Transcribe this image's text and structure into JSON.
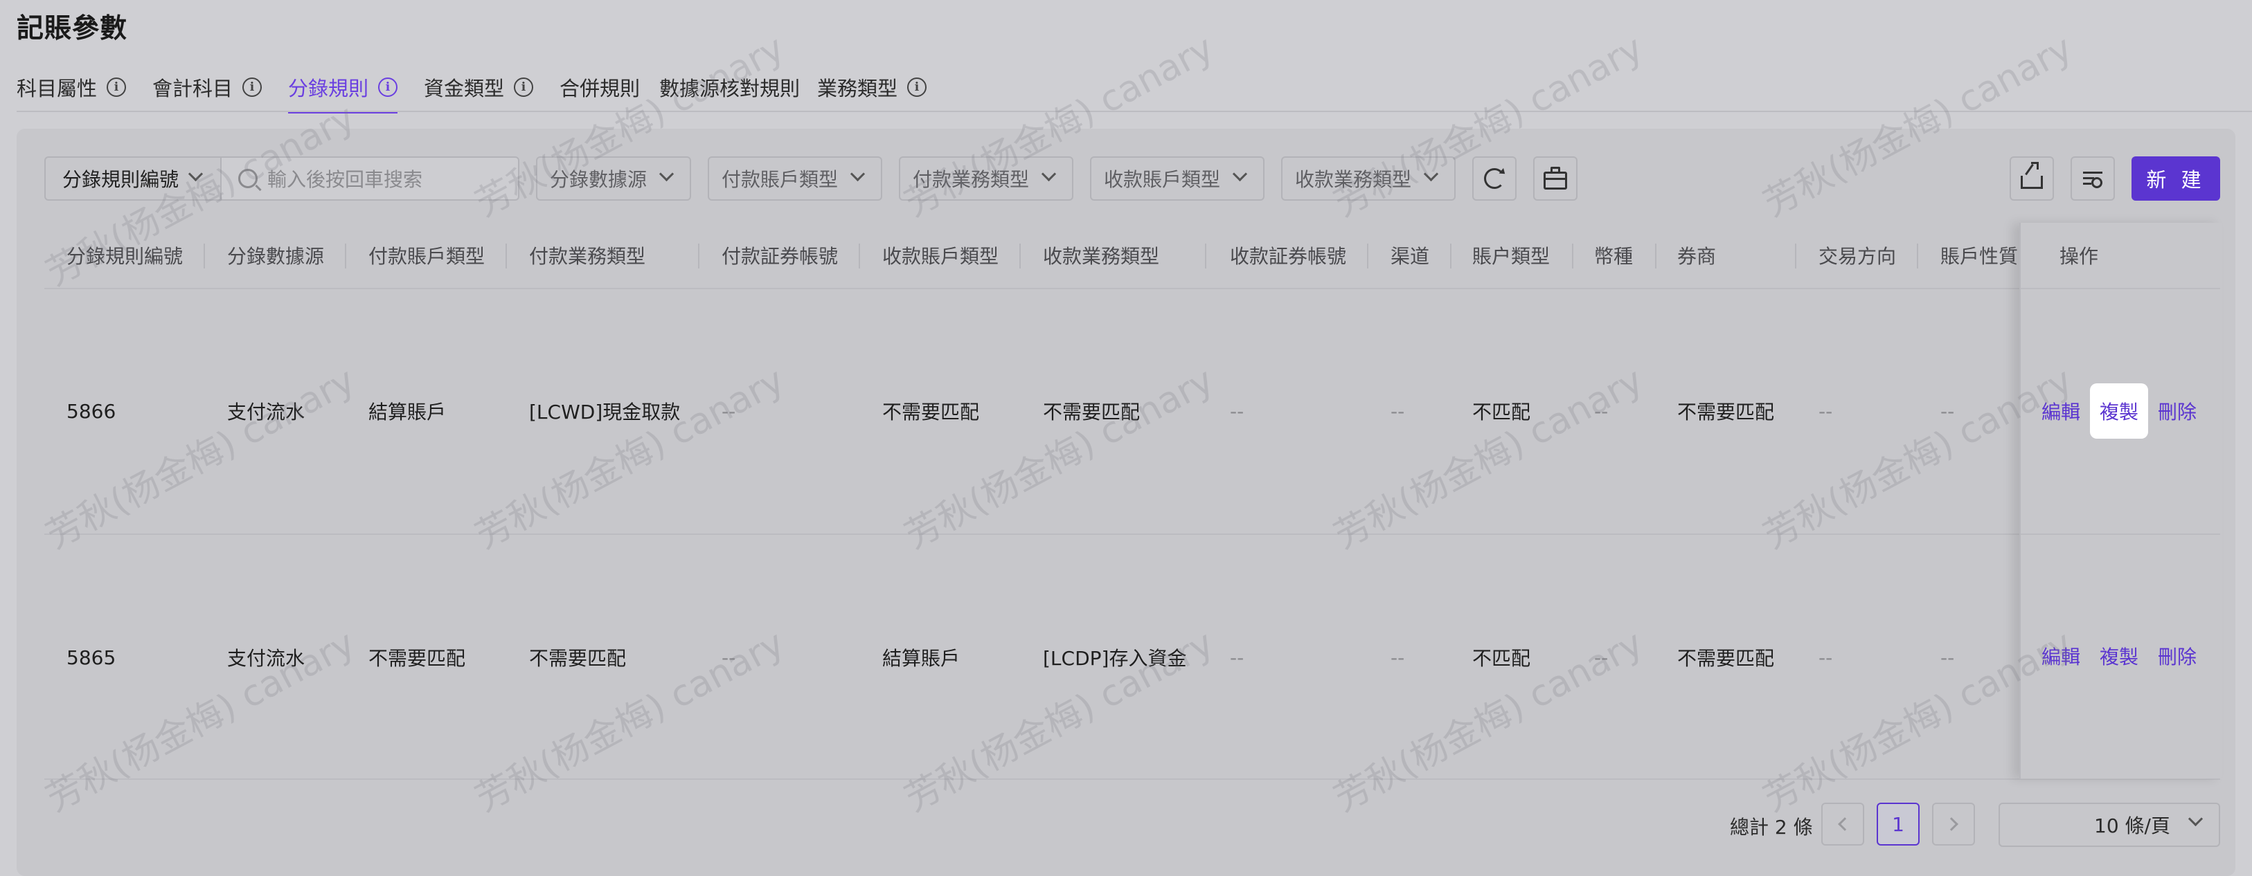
{
  "page": {
    "title": "記賬參數"
  },
  "tabs": [
    {
      "label": "科目屬性",
      "info": true
    },
    {
      "label": "會計科目",
      "info": true
    },
    {
      "label": "分錄規則",
      "info": true,
      "active": true
    },
    {
      "label": "資金類型",
      "info": true
    },
    {
      "label": "合併規則",
      "info": false
    },
    {
      "label": "數據源核對規則",
      "info": false
    },
    {
      "label": "業務類型",
      "info": true
    }
  ],
  "info_glyph": "i",
  "toolbar": {
    "search_field": "分錄規則編號",
    "search_placeholder": "輸入後按回車搜索",
    "filters": [
      "分錄數據源",
      "付款賬戶類型",
      "付款業務類型",
      "收款賬戶類型",
      "收款業務類型"
    ],
    "new_label": "新 建"
  },
  "table": {
    "columns": [
      "分錄規則編號",
      "分錄數據源",
      "付款賬戶類型",
      "付款業務類型",
      "付款証券帳號",
      "收款賬戶類型",
      "收款業務類型",
      "收款証券帳號",
      "渠道",
      "賬户類型",
      "幣種",
      "券商",
      "交易方向",
      "賬戶性質"
    ],
    "op_column": "操作",
    "rows": [
      [
        "5866",
        "支付流水",
        "結算賬戶",
        "[LCWD]現金取款",
        "--",
        "不需要匹配",
        "不需要匹配",
        "--",
        "--",
        "不匹配",
        "--",
        "不需要匹配",
        "--",
        "--"
      ],
      [
        "5865",
        "支付流水",
        "不需要匹配",
        "不需要匹配",
        "--",
        "結算賬戶",
        "[LCDP]存入資金",
        "--",
        "--",
        "不匹配",
        "--",
        "不需要匹配",
        "--",
        "--"
      ]
    ],
    "actions": [
      "編輯",
      "複製",
      "刪除"
    ]
  },
  "pagination": {
    "total": "總計 2 條",
    "current": "1",
    "page_size": "10 條/頁"
  },
  "watermark": "芳秋(杨金梅) canary",
  "colors": {
    "accent": "#5b35d0",
    "active_tab": "#6a3fe0",
    "background": "#cfcfd3"
  }
}
